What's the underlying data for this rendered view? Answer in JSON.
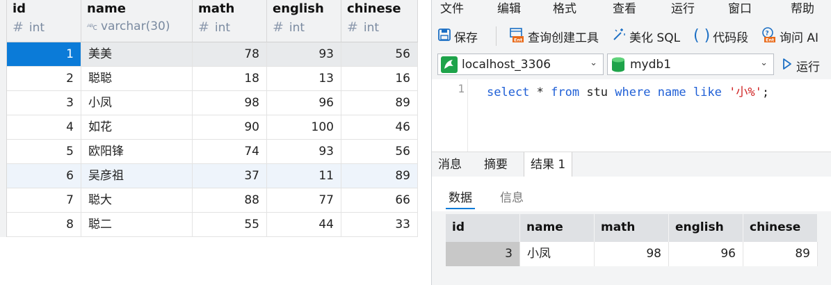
{
  "left_table": {
    "columns": [
      {
        "name": "id",
        "type": "int",
        "type_icon": "hash-icon"
      },
      {
        "name": "name",
        "type": "varchar(30)",
        "type_icon": "abc-text-icon"
      },
      {
        "name": "math",
        "type": "int",
        "type_icon": "hash-icon"
      },
      {
        "name": "english",
        "type": "int",
        "type_icon": "hash-icon"
      },
      {
        "name": "chinese",
        "type": "int",
        "type_icon": "hash-icon"
      }
    ],
    "rows": [
      [
        "1",
        "美美",
        "78",
        "93",
        "56"
      ],
      [
        "2",
        "聪聪",
        "18",
        "13",
        "16"
      ],
      [
        "3",
        "小凤",
        "98",
        "96",
        "89"
      ],
      [
        "4",
        "如花",
        "90",
        "100",
        "46"
      ],
      [
        "5",
        "欧阳锋",
        "74",
        "93",
        "56"
      ],
      [
        "6",
        "吴彦祖",
        "37",
        "11",
        "89"
      ],
      [
        "7",
        "聪大",
        "88",
        "77",
        "66"
      ],
      [
        "8",
        "聪二",
        "55",
        "44",
        "33"
      ]
    ]
  },
  "menu": [
    "文件",
    "编辑",
    "格式",
    "查看",
    "运行",
    "窗口",
    "帮助"
  ],
  "toolbar": {
    "save": "保存",
    "query_builder": "查询创建工具",
    "beautify": "美化 SQL",
    "snippet": "代码段",
    "ask_ai": "询问 AI"
  },
  "connection": {
    "server": "localhost_3306",
    "database": "mydb1",
    "run": "运行"
  },
  "editor": {
    "line_number": "1",
    "tokens": {
      "t1": "select",
      "t2": " * ",
      "t3": "from",
      "t4": " stu ",
      "t5": "where",
      "t6": " ",
      "t7": "name",
      "t8": " ",
      "t9": "like",
      "t10": " ",
      "t11": "'小%'",
      "t12": ";"
    }
  },
  "result_tabs": [
    "消息",
    "摘要",
    "结果 1"
  ],
  "sub_tabs": [
    "数据",
    "信息"
  ],
  "result_table": {
    "columns": [
      "id",
      "name",
      "math",
      "english",
      "chinese"
    ],
    "rows": [
      [
        "3",
        "小凤",
        "98",
        "96",
        "89"
      ]
    ]
  },
  "colors": {
    "accent": "#0b7bd8",
    "keyword": "#1f5fd6",
    "string": "#d02525"
  }
}
